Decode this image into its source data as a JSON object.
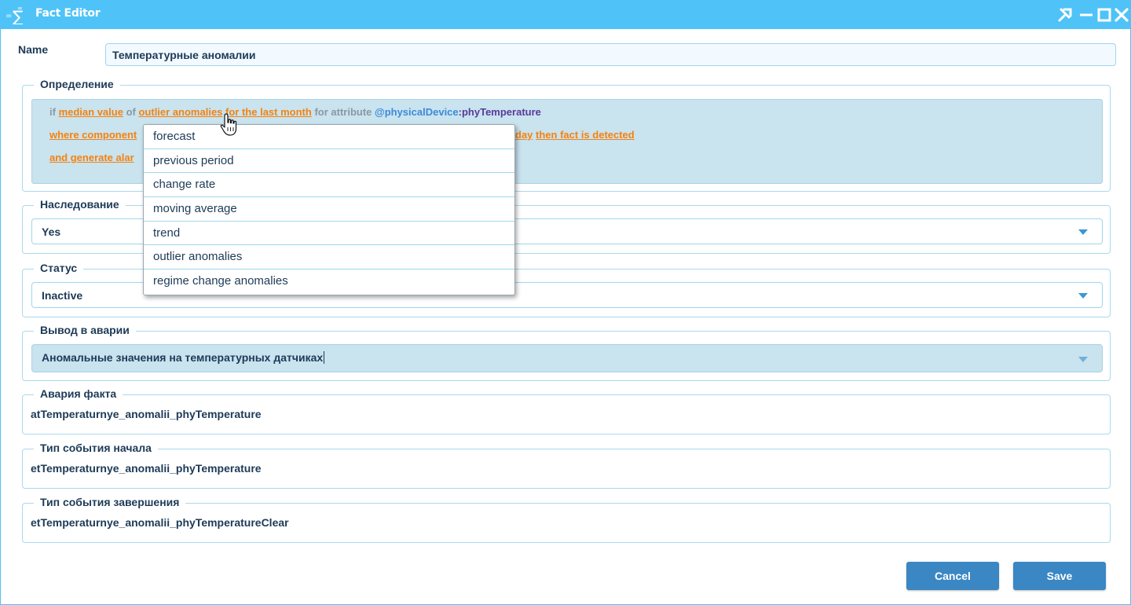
{
  "window": {
    "title": "Fact Editor"
  },
  "name": {
    "label": "Name",
    "value": "Температурные аномалии"
  },
  "definition": {
    "legend": "Определение",
    "line1": {
      "if": "if",
      "median_value": "median value",
      "of": "of",
      "outlier_anomalies": "outlier anomalies",
      "for_last_month": "for the last month",
      "for_attribute": "for attribute",
      "device": "@physicalDevice",
      "colon": ":",
      "attribute": "phyTemperature"
    },
    "line2": {
      "where_component": "where component",
      "day": "day",
      "then_detected": "then fact is detected"
    },
    "line3": {
      "and_generate": "and generate alar"
    }
  },
  "dropdown": {
    "items": [
      "forecast",
      "previous period",
      "change rate",
      "moving average",
      "trend",
      "outlier anomalies",
      "regime change anomalies"
    ]
  },
  "inheritance": {
    "legend": "Наследование",
    "value": "Yes"
  },
  "status": {
    "legend": "Статус",
    "value": "Inactive"
  },
  "alarm_output": {
    "legend": "Вывод в аварии",
    "value": "Аномальные значения на температурных датчиках"
  },
  "fact_alarm": {
    "legend": "Авария факта",
    "value": "atTemperaturnye_anomalii_phyTemperature"
  },
  "start_event": {
    "legend": "Тип события начала",
    "value": "etTemperaturnye_anomalii_phyTemperature"
  },
  "end_event": {
    "legend": "Тип события завершения",
    "value": "etTemperaturnye_anomalii_phyTemperatureClear"
  },
  "buttons": {
    "cancel": "Cancel",
    "save": "Save"
  },
  "colors": {
    "titlebar": "#4fc3f7",
    "button": "#3a87c4",
    "link": "#f5820d",
    "device": "#3d8ad9",
    "attribute": "#5a3a9a"
  },
  "icons": [
    "sum-icon",
    "pin-icon",
    "minimize-icon",
    "maximize-icon",
    "close-icon",
    "chevron-down-icon",
    "hand-cursor-icon"
  ]
}
